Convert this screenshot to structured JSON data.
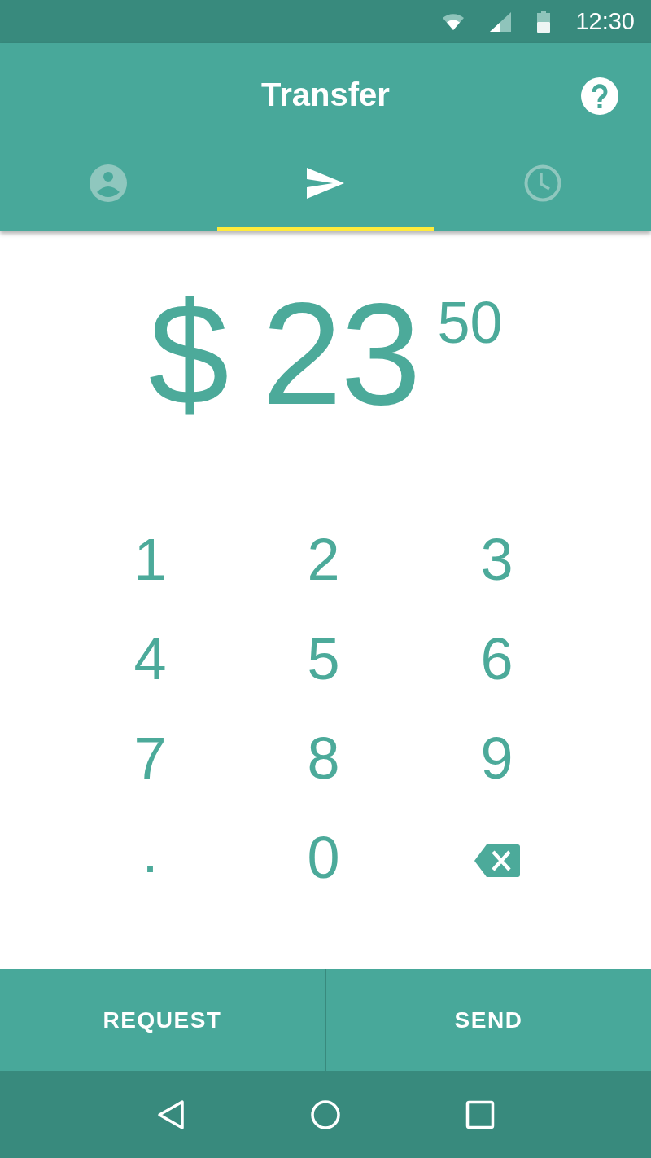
{
  "status_bar": {
    "time": "12:30"
  },
  "app_bar": {
    "title": "Transfer"
  },
  "tabs": [
    {
      "kind": "person",
      "selected": false
    },
    {
      "kind": "send",
      "selected": true
    },
    {
      "kind": "clock",
      "selected": false
    }
  ],
  "amount": {
    "currency": "$",
    "whole": "23",
    "cents": "50"
  },
  "keypad": [
    {
      "kind": "digit",
      "label": "1"
    },
    {
      "kind": "digit",
      "label": "2"
    },
    {
      "kind": "digit",
      "label": "3"
    },
    {
      "kind": "digit",
      "label": "4"
    },
    {
      "kind": "digit",
      "label": "5"
    },
    {
      "kind": "digit",
      "label": "6"
    },
    {
      "kind": "digit",
      "label": "7"
    },
    {
      "kind": "digit",
      "label": "8"
    },
    {
      "kind": "digit",
      "label": "9"
    },
    {
      "kind": "dot",
      "label": "."
    },
    {
      "kind": "digit",
      "label": "0"
    },
    {
      "kind": "backspace"
    }
  ],
  "actions": [
    {
      "label": "REQUEST"
    },
    {
      "label": "SEND"
    }
  ]
}
